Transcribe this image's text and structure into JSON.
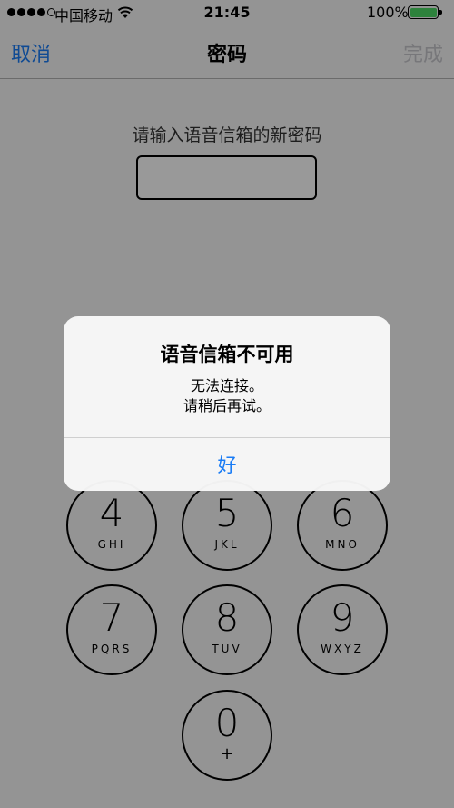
{
  "status_bar": {
    "carrier": "中国移动",
    "time": "21:45",
    "battery": "100%"
  },
  "navbar": {
    "cancel": "取消",
    "title": "密码",
    "done": "完成"
  },
  "colors": {
    "accent": "#1a7cf5",
    "disabled": "#c7c7cc",
    "battery": "#4cd964"
  },
  "prompt": "请输入语音信箱的新密码",
  "keypad": [
    {
      "digit": "4",
      "letters": "GHI"
    },
    {
      "digit": "5",
      "letters": "JKL"
    },
    {
      "digit": "6",
      "letters": "MNO"
    },
    {
      "digit": "7",
      "letters": "PQRS"
    },
    {
      "digit": "8",
      "letters": "TUV"
    },
    {
      "digit": "9",
      "letters": "WXYZ"
    },
    {
      "digit": "0",
      "letters": "+"
    }
  ],
  "alert": {
    "title": "语音信箱不可用",
    "message_line1": "无法连接。",
    "message_line2": "请稍后再试。",
    "ok": "好"
  }
}
